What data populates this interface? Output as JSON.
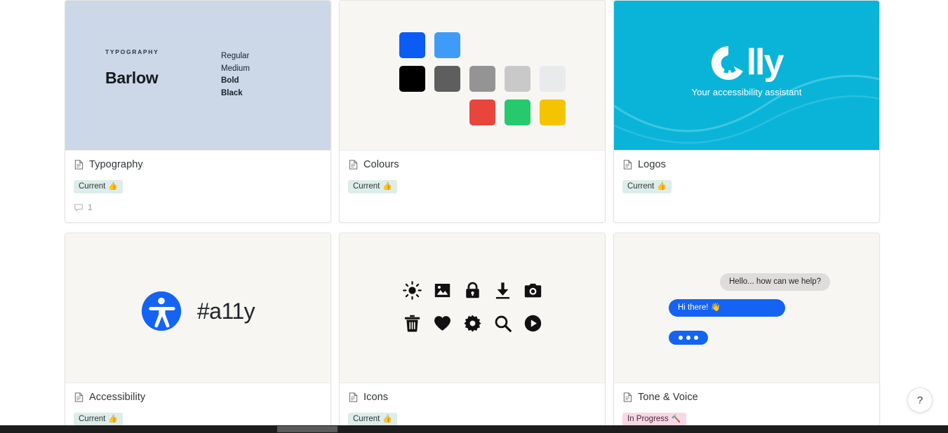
{
  "gallery": {
    "cards": [
      {
        "title": "Typography",
        "doc_icon": "document-icon",
        "status": {
          "label": "Current",
          "emoji": "👍",
          "color": "#ddedea"
        },
        "comments": {
          "icon": "comment-icon",
          "count": "1"
        },
        "preview": {
          "type": "typography",
          "background": "#ccd7e7",
          "kicker": "TYPOGRAPHY",
          "font_name": "Barlow",
          "weights": [
            "Regular",
            "Medium",
            "Bold",
            "Black"
          ]
        }
      },
      {
        "title": "Colours",
        "doc_icon": "document-icon",
        "status": {
          "label": "Current",
          "emoji": "👍",
          "color": "#ddedea"
        },
        "comments": null,
        "preview": {
          "type": "swatches",
          "background": "#f7f6f3",
          "rows": [
            [
              "#0b5cf5",
              "#3f9bfa"
            ],
            [
              "#000000",
              "#5e5e5e",
              "#949494",
              "#c9c9c9",
              "#e9eaec"
            ],
            [
              "#e8453c",
              "#26ca6d",
              "#f5c400"
            ]
          ]
        }
      },
      {
        "title": "Logos",
        "doc_icon": "document-icon",
        "status": {
          "label": "Current",
          "emoji": "👍",
          "color": "#ddedea"
        },
        "comments": null,
        "preview": {
          "type": "logo",
          "background": "#0ab4d8",
          "wordmark": "lly",
          "tagline": "Your accessibility assistant"
        }
      },
      {
        "title": "Accessibility",
        "doc_icon": "document-icon",
        "status": {
          "label": "Current",
          "emoji": "👍",
          "color": "#ddedea"
        },
        "comments": null,
        "preview": {
          "type": "a11y",
          "background": "#f7f6f3",
          "icon": "accessibility-icon",
          "hashtag": "#a11y"
        }
      },
      {
        "title": "Icons",
        "doc_icon": "document-icon",
        "status": {
          "label": "Current",
          "emoji": "👍",
          "color": "#ddedea"
        },
        "comments": null,
        "preview": {
          "type": "icons",
          "background": "#f7f6f3",
          "icons": [
            "brightness-icon",
            "image-icon",
            "lock-icon",
            "download-icon",
            "camera-icon",
            "trash-icon",
            "heart-icon",
            "gear-icon",
            "search-icon",
            "play-icon"
          ]
        }
      },
      {
        "title": "Tone & Voice",
        "doc_icon": "document-icon",
        "status": {
          "label": "In Progress",
          "emoji": "🔨",
          "color": "#f8d8e6"
        },
        "comments": null,
        "preview": {
          "type": "chat",
          "background": "#f7f6f3",
          "messages": [
            {
              "side": "right",
              "style": "grey",
              "text": "Hello... how can we help?"
            },
            {
              "side": "left",
              "style": "blue",
              "text": "Hi there! 👋"
            },
            {
              "side": "left",
              "style": "typing",
              "text": "•••"
            }
          ]
        }
      }
    ]
  },
  "help_button": {
    "label": "?",
    "name": "help-button"
  },
  "colors": {
    "page_background": "#ffffff",
    "card_background": "#ffffff",
    "preview_background": "#f7f6f3",
    "card_border": "#e6e4e0",
    "accent_blue": "#0b5cf5",
    "brand_cyan": "#0ab4d8",
    "badge_current": "#ddedea",
    "badge_progress": "#f8d8e6"
  }
}
